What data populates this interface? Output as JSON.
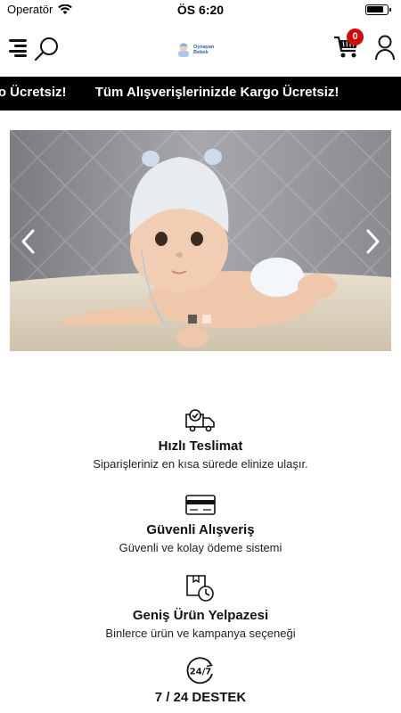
{
  "status_bar": {
    "carrier": "Operatör",
    "time": "ÖS 6:20",
    "battery_level": 0.85
  },
  "header": {
    "logo_line1": "Oynayan",
    "logo_line2": "Bebek",
    "cart_count": "0",
    "icons": [
      "menu-icon",
      "search-icon",
      "cart-icon",
      "user-icon"
    ]
  },
  "announcement": {
    "items": [
      "de Kargo Ücretsiz!",
      "Tüm Alışverişlerinizde Kargo Ücretsiz!"
    ]
  },
  "slider": {
    "slide_count": 2,
    "active_slide": 1
  },
  "features": [
    {
      "icon": "delivery-truck-icon",
      "title": "Hızlı Teslimat",
      "description": "Siparişleriniz en kısa sürede elinize ulaşır."
    },
    {
      "icon": "credit-card-icon",
      "title": "Güvenli Alışveriş",
      "description": "Güvenli ve kolay ödeme sistemi"
    },
    {
      "icon": "product-range-icon",
      "title": "Geniş Ürün Yelpazesi",
      "description": "Binlerce ürün ve kampanya seçeneği"
    },
    {
      "icon": "support-24-7-icon",
      "title": "7 / 24 DESTEK",
      "description": ""
    }
  ],
  "colors": {
    "announcement_bg": "#000000",
    "badge": "#d40a0a",
    "logo_text": "#2b5ea7"
  }
}
